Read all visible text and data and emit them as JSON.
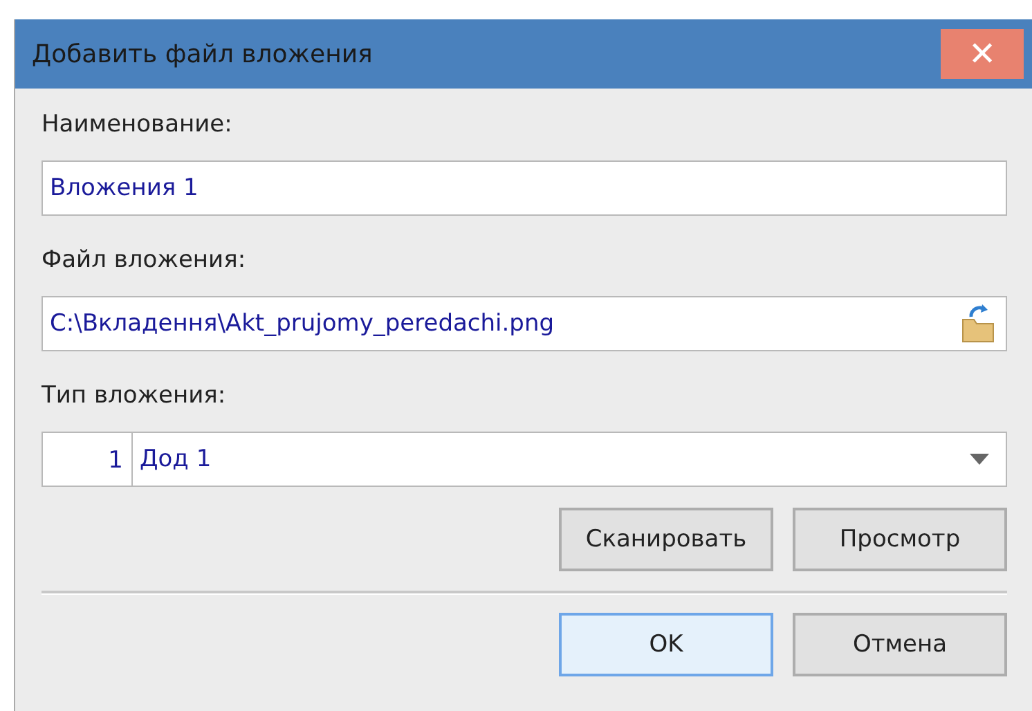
{
  "window": {
    "title": "Добавить файл вложения",
    "close": "✕"
  },
  "fields": [
    {
      "kind": "text",
      "label": "Наименование:",
      "value": "Вложения 1"
    },
    {
      "kind": "file",
      "label": "Файл вложения:",
      "value": "C:\\Вкладення\\Akt_prujomy_peredachi.png"
    },
    {
      "kind": "combo",
      "label": "Тип вложения:",
      "code": "1",
      "value": "Дод 1"
    }
  ],
  "actions": [
    {
      "label": "Сканировать",
      "focused": false
    },
    {
      "label": "Просмотр",
      "focused": false
    }
  ],
  "buttons": [
    {
      "label": "OK",
      "focused": true
    },
    {
      "label": "Отмена",
      "focused": false
    }
  ]
}
